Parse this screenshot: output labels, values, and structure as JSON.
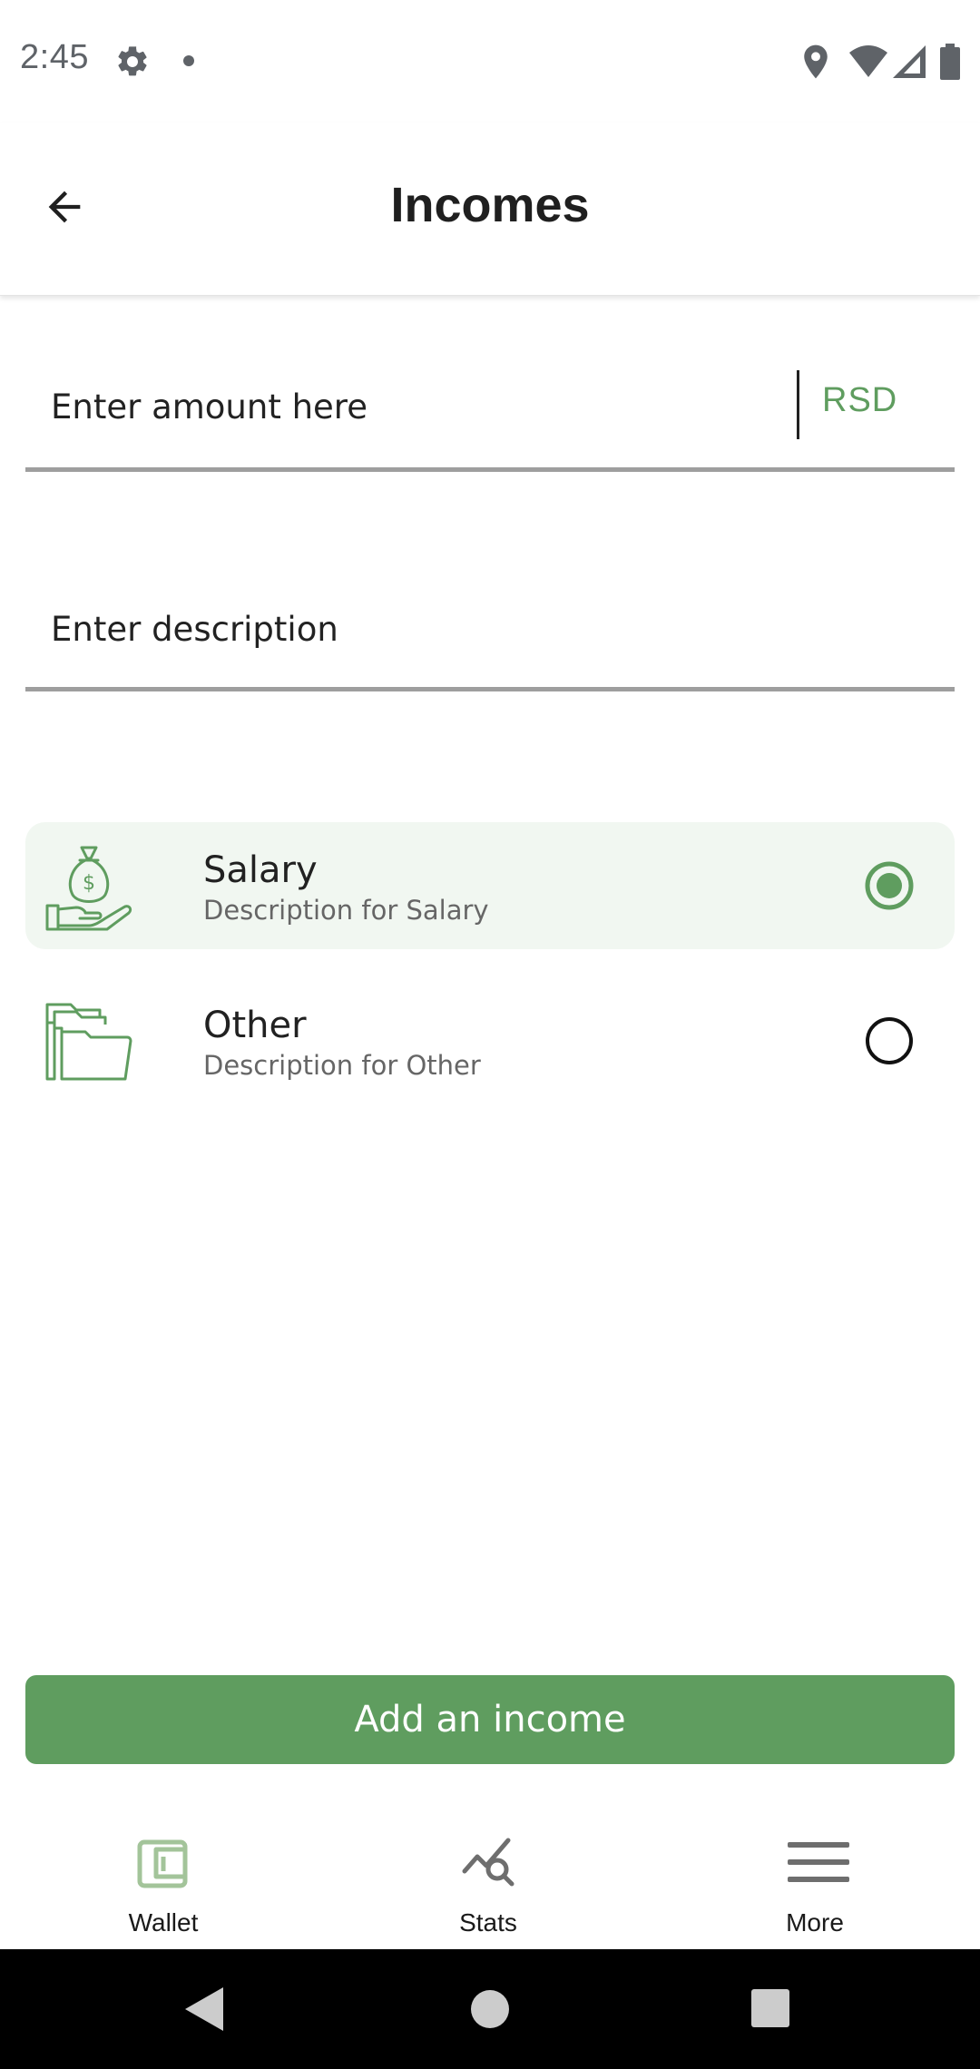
{
  "status_bar": {
    "time": "2:45",
    "icons": [
      "gear-icon",
      "notification-dot-icon",
      "location-icon",
      "wifi-icon",
      "signal-icon",
      "battery-icon"
    ]
  },
  "app_bar": {
    "title": "Incomes",
    "back_icon": "arrow-back-icon"
  },
  "form": {
    "amount_placeholder": "Enter amount here",
    "currency": "RSD",
    "description_placeholder": "Enter description"
  },
  "income_types": [
    {
      "title": "Salary",
      "description": "Description for Salary",
      "icon": "money-bag-hand-icon",
      "selected": true
    },
    {
      "title": "Other",
      "description": "Description for Other",
      "icon": "folders-icon",
      "selected": false
    }
  ],
  "primary_action": {
    "label": "Add an income"
  },
  "bottom_nav": {
    "items": [
      {
        "label": "Wallet",
        "icon": "wallet-icon",
        "active": true
      },
      {
        "label": "Stats",
        "icon": "stats-icon",
        "active": false
      },
      {
        "label": "More",
        "icon": "menu-icon",
        "active": false
      }
    ]
  },
  "colors": {
    "accent": "#5f9d5f",
    "selected_row_background": "#f1f7f1",
    "text_primary": "#212121",
    "text_secondary": "#666666",
    "underline": "#9e9e9e",
    "system_nav_background": "#000000"
  }
}
